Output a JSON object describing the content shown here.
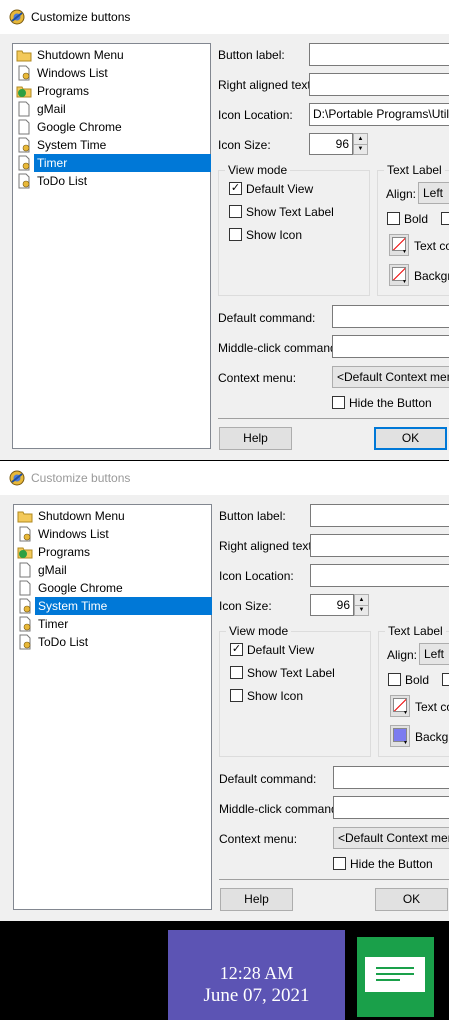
{
  "dialog_top": {
    "title": "Customize buttons",
    "title_active": true,
    "tree_items": [
      {
        "label": "Shutdown Menu",
        "icon": "folder-icon",
        "selected": false
      },
      {
        "label": "Windows List",
        "icon": "document-icon",
        "selected": false
      },
      {
        "label": "Programs",
        "icon": "folder-green-icon",
        "selected": false
      },
      {
        "label": "gMail",
        "icon": "document-icon",
        "selected": false
      },
      {
        "label": "Google Chrome",
        "icon": "document-icon",
        "selected": false
      },
      {
        "label": "System Time",
        "icon": "document-icon",
        "selected": false
      },
      {
        "label": "Timer",
        "icon": "document-icon",
        "selected": true
      },
      {
        "label": "ToDo List",
        "icon": "document-icon",
        "selected": false
      }
    ],
    "labels": {
      "button_label": "Button label:",
      "right_aligned": "Right aligned text:",
      "icon_location": "Icon Location:",
      "icon_size": "Icon Size:",
      "default_command": "Default command:",
      "middle_click": "Middle-click command:",
      "context_menu": "Context menu:"
    },
    "values": {
      "button_label": "",
      "right_aligned": "",
      "icon_location": "D:\\Portable Programs\\Utilitie",
      "icon_size": "96",
      "default_command": "",
      "middle_click": "",
      "context_menu": "<Default Context menu>"
    },
    "view_mode": {
      "title": "View mode",
      "default_view": {
        "label": "Default View",
        "checked": true
      },
      "show_text_label": {
        "label": "Show Text Label",
        "checked": false
      },
      "show_icon": {
        "label": "Show Icon",
        "checked": false
      }
    },
    "text_label": {
      "title": "Text Label",
      "align_label": "Align:",
      "align_value": "Left",
      "bold": {
        "label": "Bold",
        "checked": false
      },
      "text_color_label": "Text co",
      "background_label": "Backgr",
      "background_color": "#ffffff"
    },
    "hide_button": {
      "label": "Hide the Button",
      "checked": false
    },
    "help": "Help",
    "ok": "OK"
  },
  "dialog_bottom": {
    "title": "Customize buttons",
    "title_active": false,
    "tree_items": [
      {
        "label": "Shutdown Menu",
        "icon": "folder-icon",
        "selected": false
      },
      {
        "label": "Windows List",
        "icon": "document-icon",
        "selected": false
      },
      {
        "label": "Programs",
        "icon": "folder-green-icon",
        "selected": false
      },
      {
        "label": "gMail",
        "icon": "document-icon",
        "selected": false
      },
      {
        "label": "Google Chrome",
        "icon": "document-icon",
        "selected": false
      },
      {
        "label": "System Time",
        "icon": "document-icon",
        "selected": true
      },
      {
        "label": "Timer",
        "icon": "document-icon",
        "selected": false
      },
      {
        "label": "ToDo List",
        "icon": "document-icon",
        "selected": false
      }
    ],
    "labels": {
      "button_label": "Button label:",
      "right_aligned": "Right aligned text:",
      "icon_location": "Icon Location:",
      "icon_size": "Icon Size:",
      "default_command": "Default command:",
      "middle_click": "Middle-click command:",
      "context_menu": "Context menu:"
    },
    "values": {
      "button_label": "",
      "right_aligned": "",
      "icon_location": "",
      "icon_size": "96",
      "default_command": "",
      "middle_click": "",
      "context_menu": "<Default Context menu>"
    },
    "view_mode": {
      "title": "View mode",
      "default_view": {
        "label": "Default View",
        "checked": true
      },
      "show_text_label": {
        "label": "Show Text Label",
        "checked": false
      },
      "show_icon": {
        "label": "Show Icon",
        "checked": false
      }
    },
    "text_label": {
      "title": "Text Label",
      "align_label": "Align:",
      "align_value": "Left",
      "bold": {
        "label": "Bold",
        "checked": false
      },
      "text_color_label": "Text co",
      "background_label": "Backgr",
      "background_color": "#7c7cf0"
    },
    "hide_button": {
      "label": "Hide the Button",
      "checked": false
    },
    "help": "Help",
    "ok": "OK"
  },
  "taskbar": {
    "clock_time": "12:28 AM",
    "clock_date": "June 07, 2021",
    "clock_color": "#5c54b4",
    "keep_color": "#1aa04a"
  }
}
